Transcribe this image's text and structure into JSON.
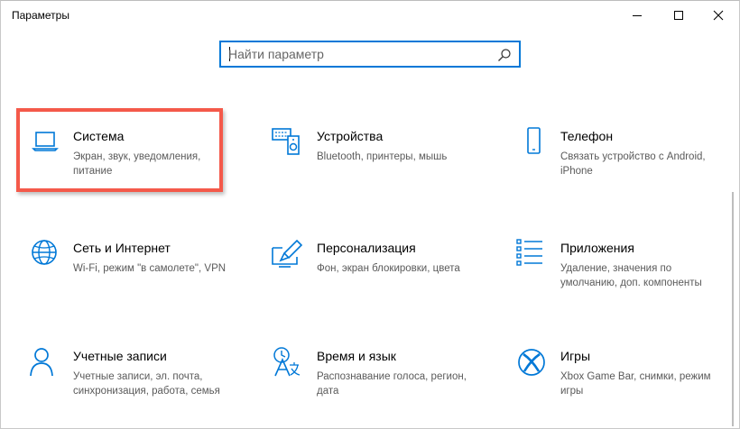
{
  "window": {
    "title": "Параметры",
    "controls": [
      "minimize-icon",
      "maximize-icon",
      "close-icon"
    ]
  },
  "search": {
    "placeholder": "Найти параметр",
    "value": "",
    "icon": "search-icon"
  },
  "accent_color": "#0078d7",
  "highlight_color": "#f4594a",
  "categories": [
    {
      "name": "Система",
      "desc": "Экран, звук, уведомления, питание",
      "icon": "laptop-icon",
      "highlighted": true
    },
    {
      "name": "Устройства",
      "desc": "Bluetooth, принтеры, мышь",
      "icon": "devices-icon"
    },
    {
      "name": "Телефон",
      "desc": "Связать устройство с Android, iPhone",
      "icon": "phone-icon"
    },
    {
      "name": "Сеть и Интернет",
      "desc": "Wi-Fi, режим \"в самолете\", VPN",
      "icon": "globe-icon"
    },
    {
      "name": "Персонализация",
      "desc": "Фон, экран блокировки, цвета",
      "icon": "paint-icon"
    },
    {
      "name": "Приложения",
      "desc": "Удаление, значения по умолчанию, доп. компоненты",
      "icon": "apps-list-icon"
    },
    {
      "name": "Учетные записи",
      "desc": "Учетные записи, эл. почта, синхронизация, работа, семья",
      "icon": "person-icon"
    },
    {
      "name": "Время и язык",
      "desc": "Распознавание голоса, регион, дата",
      "icon": "time-language-icon"
    },
    {
      "name": "Игры",
      "desc": "Xbox Game Bar, снимки, режим игры",
      "icon": "xbox-icon"
    }
  ]
}
